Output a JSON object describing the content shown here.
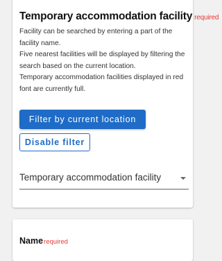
{
  "facility_section": {
    "title": "Temporary accommodation facility",
    "required_label": "required",
    "description_lines": [
      "Facility can be searched by entering a part of the facility name.",
      "Five nearest facilities will be displayed by filtering the search based on the current location.",
      "Temporary accommodation facilities displayed in red font are currently full."
    ],
    "filter_button_label": "Filter by current location",
    "disable_filter_button_label": "Disable filter",
    "select": {
      "value": "Temporary accommodation facility",
      "icon": "chevron-down-icon"
    }
  },
  "name_section": {
    "label": "Name",
    "required_label": "required"
  },
  "colors": {
    "accent": "#1e6cc7",
    "required": "#e53935",
    "background": "#f1f1f1"
  }
}
